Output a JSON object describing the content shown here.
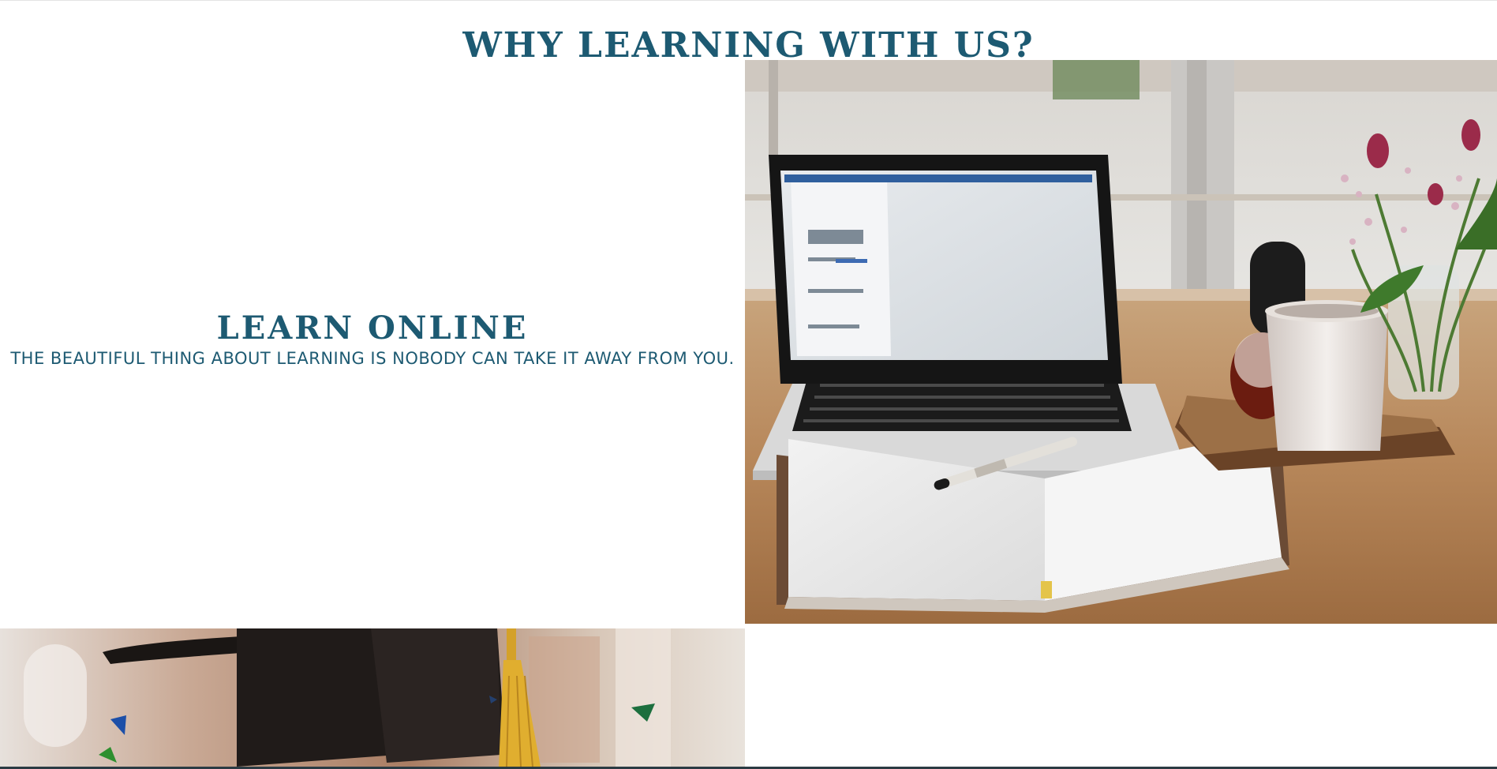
{
  "section": {
    "title": "WHY LEARNING WITH US?"
  },
  "feature": {
    "heading": "LEARN ONLINE",
    "description": "THE BEAUTIFUL THING ABOUT LEARNING IS NOBODY CAN TAKE IT AWAY FROM YOU."
  },
  "images": {
    "laptop": {
      "icon": "laptop-desk-photo"
    },
    "graduation": {
      "icon": "graduation-cap-photo"
    }
  },
  "colors": {
    "brand": "#1d5a72",
    "background": "#ffffff",
    "footer_strip": "#2b3b43"
  }
}
